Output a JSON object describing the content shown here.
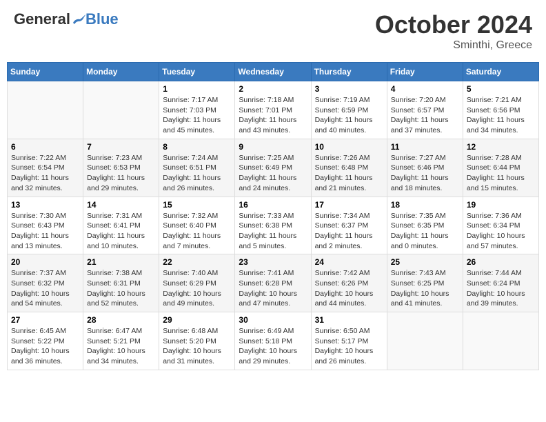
{
  "header": {
    "logo_general": "General",
    "logo_blue": "Blue",
    "month_year": "October 2024",
    "location": "Sminthi, Greece"
  },
  "weekdays": [
    "Sunday",
    "Monday",
    "Tuesday",
    "Wednesday",
    "Thursday",
    "Friday",
    "Saturday"
  ],
  "weeks": [
    [
      {
        "day": "",
        "content": ""
      },
      {
        "day": "",
        "content": ""
      },
      {
        "day": "1",
        "content": "Sunrise: 7:17 AM\nSunset: 7:03 PM\nDaylight: 11 hours and 45 minutes."
      },
      {
        "day": "2",
        "content": "Sunrise: 7:18 AM\nSunset: 7:01 PM\nDaylight: 11 hours and 43 minutes."
      },
      {
        "day": "3",
        "content": "Sunrise: 7:19 AM\nSunset: 6:59 PM\nDaylight: 11 hours and 40 minutes."
      },
      {
        "day": "4",
        "content": "Sunrise: 7:20 AM\nSunset: 6:57 PM\nDaylight: 11 hours and 37 minutes."
      },
      {
        "day": "5",
        "content": "Sunrise: 7:21 AM\nSunset: 6:56 PM\nDaylight: 11 hours and 34 minutes."
      }
    ],
    [
      {
        "day": "6",
        "content": "Sunrise: 7:22 AM\nSunset: 6:54 PM\nDaylight: 11 hours and 32 minutes."
      },
      {
        "day": "7",
        "content": "Sunrise: 7:23 AM\nSunset: 6:53 PM\nDaylight: 11 hours and 29 minutes."
      },
      {
        "day": "8",
        "content": "Sunrise: 7:24 AM\nSunset: 6:51 PM\nDaylight: 11 hours and 26 minutes."
      },
      {
        "day": "9",
        "content": "Sunrise: 7:25 AM\nSunset: 6:49 PM\nDaylight: 11 hours and 24 minutes."
      },
      {
        "day": "10",
        "content": "Sunrise: 7:26 AM\nSunset: 6:48 PM\nDaylight: 11 hours and 21 minutes."
      },
      {
        "day": "11",
        "content": "Sunrise: 7:27 AM\nSunset: 6:46 PM\nDaylight: 11 hours and 18 minutes."
      },
      {
        "day": "12",
        "content": "Sunrise: 7:28 AM\nSunset: 6:44 PM\nDaylight: 11 hours and 15 minutes."
      }
    ],
    [
      {
        "day": "13",
        "content": "Sunrise: 7:30 AM\nSunset: 6:43 PM\nDaylight: 11 hours and 13 minutes."
      },
      {
        "day": "14",
        "content": "Sunrise: 7:31 AM\nSunset: 6:41 PM\nDaylight: 11 hours and 10 minutes."
      },
      {
        "day": "15",
        "content": "Sunrise: 7:32 AM\nSunset: 6:40 PM\nDaylight: 11 hours and 7 minutes."
      },
      {
        "day": "16",
        "content": "Sunrise: 7:33 AM\nSunset: 6:38 PM\nDaylight: 11 hours and 5 minutes."
      },
      {
        "day": "17",
        "content": "Sunrise: 7:34 AM\nSunset: 6:37 PM\nDaylight: 11 hours and 2 minutes."
      },
      {
        "day": "18",
        "content": "Sunrise: 7:35 AM\nSunset: 6:35 PM\nDaylight: 11 hours and 0 minutes."
      },
      {
        "day": "19",
        "content": "Sunrise: 7:36 AM\nSunset: 6:34 PM\nDaylight: 10 hours and 57 minutes."
      }
    ],
    [
      {
        "day": "20",
        "content": "Sunrise: 7:37 AM\nSunset: 6:32 PM\nDaylight: 10 hours and 54 minutes."
      },
      {
        "day": "21",
        "content": "Sunrise: 7:38 AM\nSunset: 6:31 PM\nDaylight: 10 hours and 52 minutes."
      },
      {
        "day": "22",
        "content": "Sunrise: 7:40 AM\nSunset: 6:29 PM\nDaylight: 10 hours and 49 minutes."
      },
      {
        "day": "23",
        "content": "Sunrise: 7:41 AM\nSunset: 6:28 PM\nDaylight: 10 hours and 47 minutes."
      },
      {
        "day": "24",
        "content": "Sunrise: 7:42 AM\nSunset: 6:26 PM\nDaylight: 10 hours and 44 minutes."
      },
      {
        "day": "25",
        "content": "Sunrise: 7:43 AM\nSunset: 6:25 PM\nDaylight: 10 hours and 41 minutes."
      },
      {
        "day": "26",
        "content": "Sunrise: 7:44 AM\nSunset: 6:24 PM\nDaylight: 10 hours and 39 minutes."
      }
    ],
    [
      {
        "day": "27",
        "content": "Sunrise: 6:45 AM\nSunset: 5:22 PM\nDaylight: 10 hours and 36 minutes."
      },
      {
        "day": "28",
        "content": "Sunrise: 6:47 AM\nSunset: 5:21 PM\nDaylight: 10 hours and 34 minutes."
      },
      {
        "day": "29",
        "content": "Sunrise: 6:48 AM\nSunset: 5:20 PM\nDaylight: 10 hours and 31 minutes."
      },
      {
        "day": "30",
        "content": "Sunrise: 6:49 AM\nSunset: 5:18 PM\nDaylight: 10 hours and 29 minutes."
      },
      {
        "day": "31",
        "content": "Sunrise: 6:50 AM\nSunset: 5:17 PM\nDaylight: 10 hours and 26 minutes."
      },
      {
        "day": "",
        "content": ""
      },
      {
        "day": "",
        "content": ""
      }
    ]
  ]
}
